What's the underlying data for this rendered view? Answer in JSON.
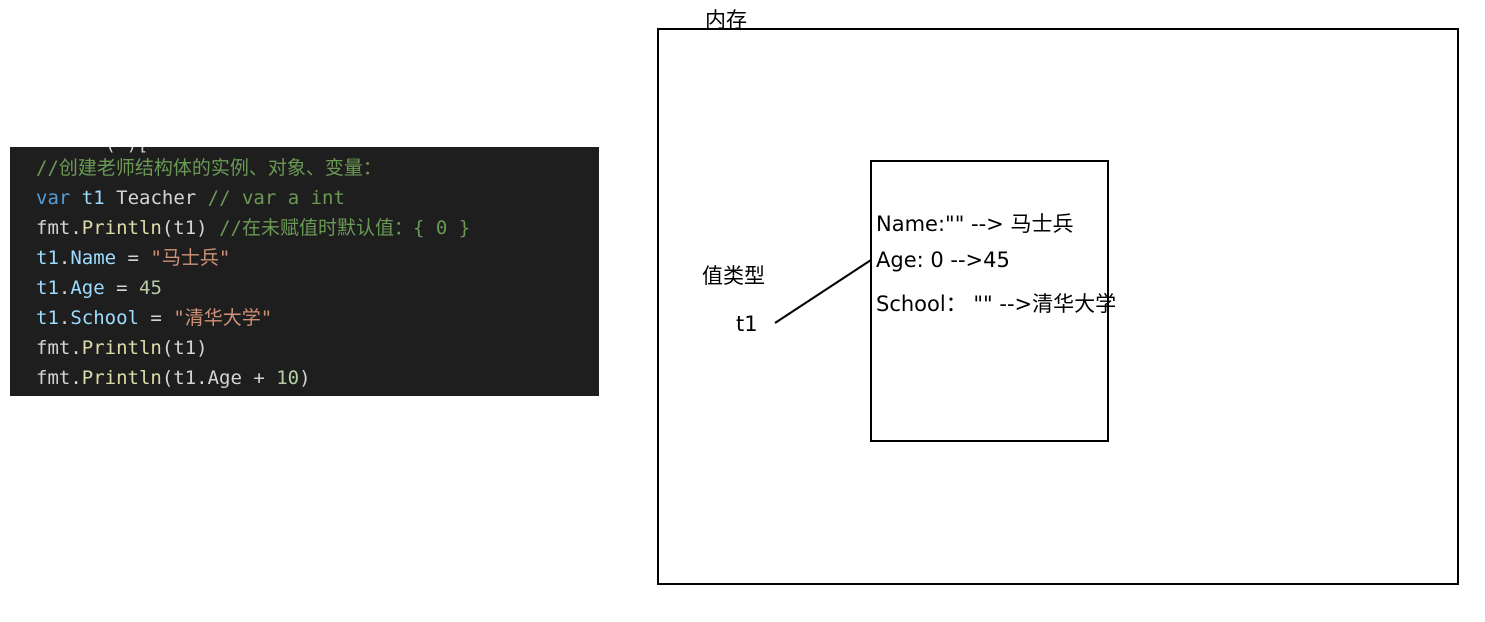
{
  "code": {
    "clipped_text": "( )[",
    "lines": [
      [
        {
          "t": "comment",
          "s": "//创建老师结构体的实例、对象、变量："
        }
      ],
      [
        {
          "t": "keyword",
          "s": "var"
        },
        {
          "t": "ident",
          "s": " "
        },
        {
          "t": "var",
          "s": "t1"
        },
        {
          "t": "ident",
          "s": " "
        },
        {
          "t": "type",
          "s": "Teacher"
        },
        {
          "t": "ident",
          "s": " "
        },
        {
          "t": "comment",
          "s": "// var a int"
        }
      ],
      [
        {
          "t": "ident",
          "s": "fmt."
        },
        {
          "t": "func",
          "s": "Println"
        },
        {
          "t": "punct",
          "s": "(t1)"
        },
        {
          "t": "ident",
          "s": " "
        },
        {
          "t": "comment",
          "s": "//在未赋值时默认值：{ 0 }"
        }
      ],
      [
        {
          "t": "var",
          "s": "t1"
        },
        {
          "t": "punct",
          "s": "."
        },
        {
          "t": "var",
          "s": "Name"
        },
        {
          "t": "punct",
          "s": " = "
        },
        {
          "t": "string",
          "s": "\"马士兵\""
        }
      ],
      [
        {
          "t": "var",
          "s": "t1"
        },
        {
          "t": "punct",
          "s": "."
        },
        {
          "t": "var",
          "s": "Age"
        },
        {
          "t": "punct",
          "s": " = "
        },
        {
          "t": "number",
          "s": "45"
        }
      ],
      [
        {
          "t": "var",
          "s": "t1"
        },
        {
          "t": "punct",
          "s": "."
        },
        {
          "t": "var",
          "s": "School"
        },
        {
          "t": "punct",
          "s": " = "
        },
        {
          "t": "string",
          "s": "\"清华大学\""
        }
      ],
      [
        {
          "t": "ident",
          "s": "fmt."
        },
        {
          "t": "func",
          "s": "Println"
        },
        {
          "t": "punct",
          "s": "(t1)"
        }
      ],
      [
        {
          "t": "ident",
          "s": "fmt."
        },
        {
          "t": "func",
          "s": "Println"
        },
        {
          "t": "punct",
          "s": "(t1.Age + "
        },
        {
          "t": "number",
          "s": "10"
        },
        {
          "t": "punct",
          "s": ")"
        }
      ]
    ]
  },
  "diagram": {
    "memory_label": "内存",
    "value_type_label": "值类型",
    "variable_label": "t1",
    "fields": [
      "Name:\"\" --> 马士兵",
      "Age: 0 -->45",
      "School： \"\" -->清华大学"
    ]
  }
}
